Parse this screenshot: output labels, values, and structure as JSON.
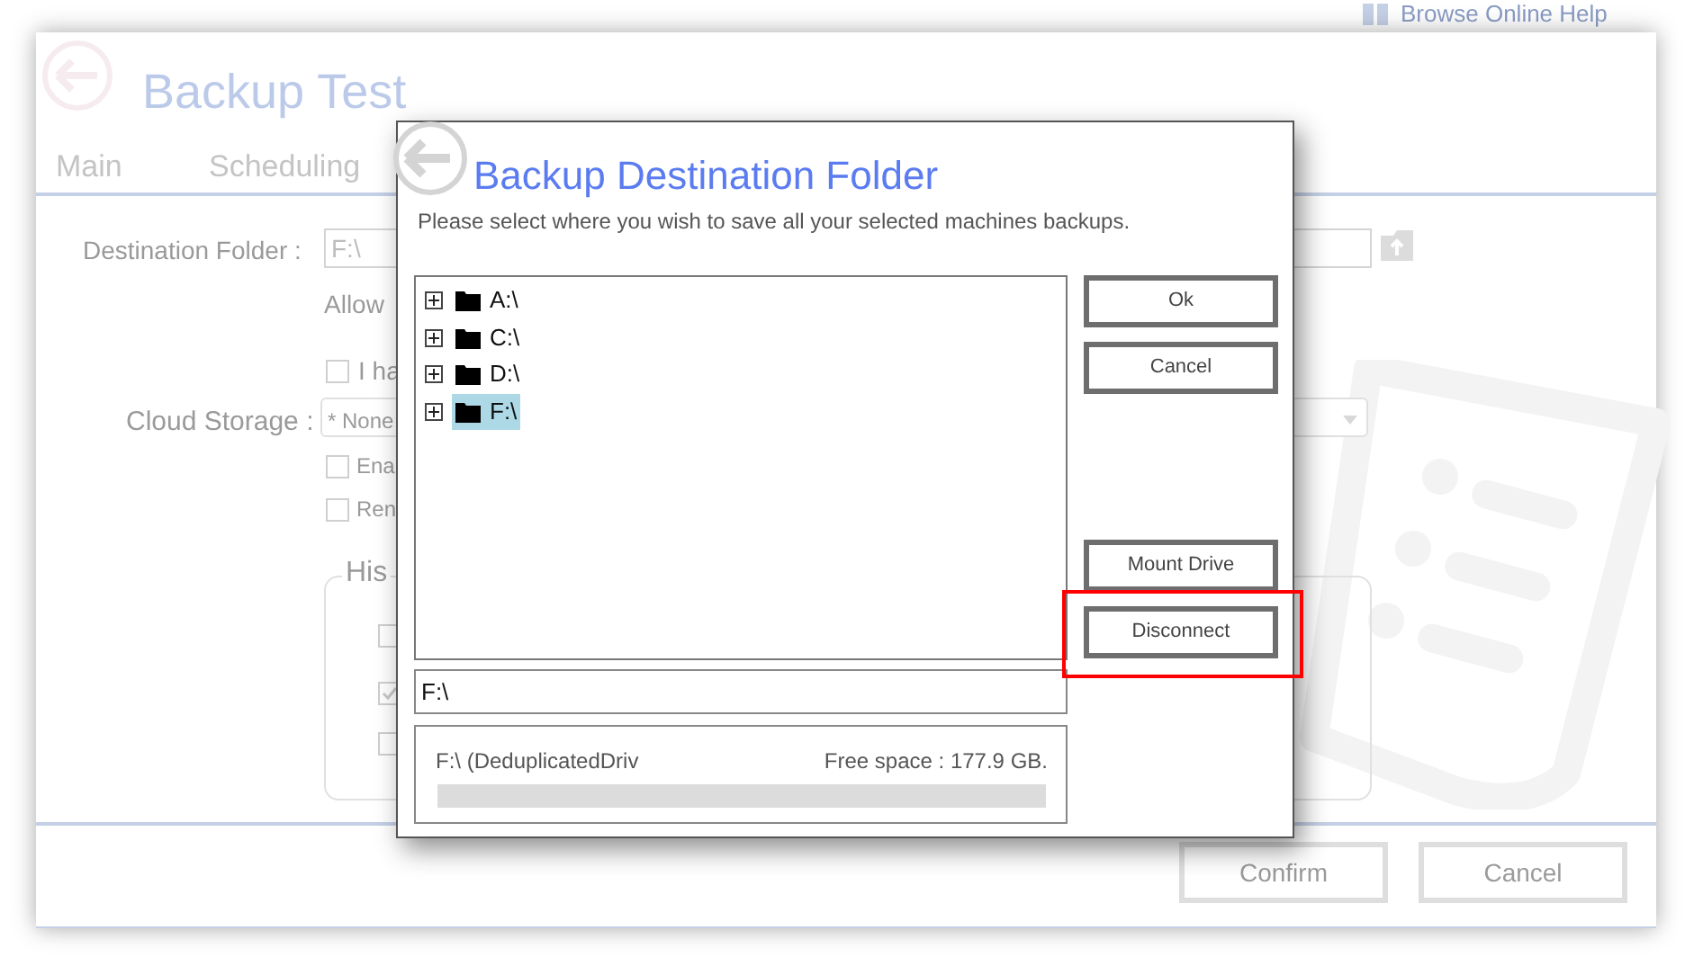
{
  "help_link": {
    "label": "Browse Online Help"
  },
  "window": {
    "title": "Backup Test"
  },
  "tabs": [
    {
      "label": "Main",
      "selected": false
    },
    {
      "label": "Scheduling",
      "selected": false
    }
  ],
  "form": {
    "destination_label": "Destination Folder :",
    "destination_value": "F:\\",
    "allow_text": "Allow",
    "option_1": {
      "label": "I ha",
      "checked": false
    },
    "cloud_label": "Cloud Storage :",
    "cloud_value": "* None",
    "option_2": {
      "label": "Ena",
      "checked": false
    },
    "option_3": {
      "label": "Ren",
      "checked": false
    },
    "group_title": "His",
    "group_checks": [
      {
        "checked": false
      },
      {
        "checked": true
      },
      {
        "checked": false
      }
    ]
  },
  "footer_buttons": [
    "Confirm",
    "Cancel"
  ],
  "dialog": {
    "title": "Backup Destination Folder",
    "subtitle": "Please select where you wish to save all your selected machines backups.",
    "tree": [
      {
        "label": "A:\\",
        "selected": false
      },
      {
        "label": "C:\\",
        "selected": false
      },
      {
        "label": "D:\\",
        "selected": false
      },
      {
        "label": "F:\\",
        "selected": true
      }
    ],
    "path": "F:\\",
    "drive_name": "F:\\ (DeduplicatedDriv",
    "free_space": "Free space : 177.9 GB.",
    "buttons": [
      {
        "label": "Ok",
        "highlighted": false
      },
      {
        "label": "Cancel",
        "highlighted": false
      },
      {
        "label": "Mount Drive",
        "highlighted": false
      },
      {
        "label": "Disconnect",
        "highlighted": true
      }
    ]
  }
}
